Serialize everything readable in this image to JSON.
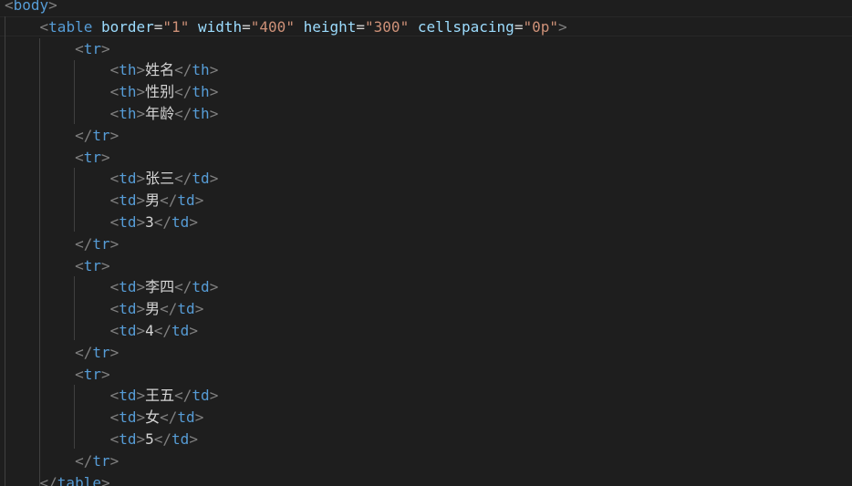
{
  "editor": {
    "lines": {
      "l0": {
        "open": "<",
        "tag": "body",
        "close": ">"
      },
      "l1": {
        "open": "<",
        "tag": "table",
        "attrs": [
          {
            "name": "border",
            "eq": "=",
            "value": "\"1\""
          },
          {
            "name": "width",
            "eq": "=",
            "value": "\"400\""
          },
          {
            "name": "height",
            "eq": "=",
            "value": "\"300\""
          },
          {
            "name": "cellspacing",
            "eq": "=",
            "value": "\"0p\""
          }
        ],
        "close": ">"
      },
      "l2": {
        "open": "<",
        "tag": "tr",
        "close": ">"
      },
      "l3": {
        "open": "<",
        "tag": "th",
        "gt": ">",
        "text": "姓名",
        "end_open": "</",
        "end_tag": "th",
        "close": ">"
      },
      "l4": {
        "open": "<",
        "tag": "th",
        "gt": ">",
        "text": "性别",
        "end_open": "</",
        "end_tag": "th",
        "close": ">"
      },
      "l5": {
        "open": "<",
        "tag": "th",
        "gt": ">",
        "text": "年龄",
        "end_open": "</",
        "end_tag": "th",
        "close": ">"
      },
      "l6": {
        "open": "</",
        "tag": "tr",
        "close": ">"
      },
      "l7": {
        "open": "<",
        "tag": "tr",
        "close": ">"
      },
      "l8": {
        "open": "<",
        "tag": "td",
        "gt": ">",
        "text": "张三",
        "end_open": "</",
        "end_tag": "td",
        "close": ">"
      },
      "l9": {
        "open": "<",
        "tag": "td",
        "gt": ">",
        "text": "男",
        "end_open": "</",
        "end_tag": "td",
        "close": ">"
      },
      "l10": {
        "open": "<",
        "tag": "td",
        "gt": ">",
        "text": "3",
        "end_open": "</",
        "end_tag": "td",
        "close": ">"
      },
      "l11": {
        "open": "</",
        "tag": "tr",
        "close": ">"
      },
      "l12": {
        "open": "<",
        "tag": "tr",
        "close": ">"
      },
      "l13": {
        "open": "<",
        "tag": "td",
        "gt": ">",
        "text": "李四",
        "end_open": "</",
        "end_tag": "td",
        "close": ">"
      },
      "l14": {
        "open": "<",
        "tag": "td",
        "gt": ">",
        "text": "男",
        "end_open": "</",
        "end_tag": "td",
        "close": ">"
      },
      "l15": {
        "open": "<",
        "tag": "td",
        "gt": ">",
        "text": "4",
        "end_open": "</",
        "end_tag": "td",
        "close": ">"
      },
      "l16": {
        "open": "</",
        "tag": "tr",
        "close": ">"
      },
      "l17": {
        "open": "<",
        "tag": "tr",
        "close": ">"
      },
      "l18": {
        "open": "<",
        "tag": "td",
        "gt": ">",
        "text": "王五",
        "end_open": "</",
        "end_tag": "td",
        "close": ">"
      },
      "l19": {
        "open": "<",
        "tag": "td",
        "gt": ">",
        "text": "女",
        "end_open": "</",
        "end_tag": "td",
        "close": ">"
      },
      "l20": {
        "open": "<",
        "tag": "td",
        "gt": ">",
        "text": "5",
        "end_open": "</",
        "end_tag": "td",
        "close": ">"
      },
      "l21": {
        "open": "</",
        "tag": "tr",
        "close": ">"
      },
      "l22": {
        "open": "</",
        "tag": "table",
        "close": ">"
      }
    }
  }
}
